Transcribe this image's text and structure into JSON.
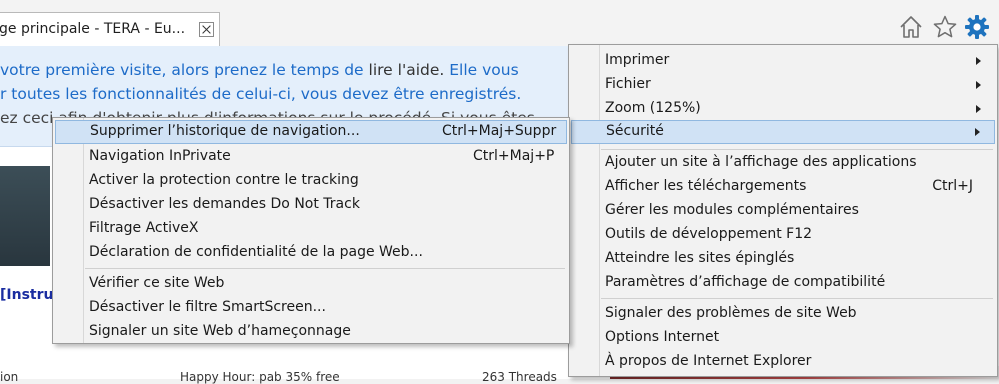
{
  "tab": {
    "title": "ge principale - TERA - Eu..."
  },
  "toolbar": {
    "home_icon": "home-icon",
    "favorites_icon": "star-icon",
    "tools_icon": "gear-icon",
    "accent": "#1e73be"
  },
  "page": {
    "notice_line1_a": "votre première visite, alors prenez le temps de ",
    "notice_line1_b": "lire l'aide.",
    "notice_line1_c": " Elle vous",
    "notice_line2": "r toutes les fonctionnalités de celui-ci, vous devez être enregistrés.",
    "notice_line3": "ez ceci afin d'obtenir plus d'informations sur le procédé. Si vous êtes",
    "instru": "[Instru",
    "bottom_left": "ion",
    "bottom_mid": "Happy Hour: pab 35% free",
    "bottom_right": "263 Threads"
  },
  "main_menu": {
    "items": [
      {
        "label": "Imprimer",
        "shortcut": "",
        "submenu": true
      },
      {
        "label": "Fichier",
        "shortcut": "",
        "submenu": true
      },
      {
        "label": "Zoom (125%)",
        "shortcut": "",
        "submenu": true
      },
      {
        "label": "Sécurité",
        "shortcut": "",
        "submenu": true
      },
      {
        "label": "Ajouter un site à l’affichage des applications",
        "shortcut": "",
        "submenu": false
      },
      {
        "label": "Afficher les téléchargements",
        "shortcut": "Ctrl+J",
        "submenu": false
      },
      {
        "label": "Gérer les modules complémentaires",
        "shortcut": "",
        "submenu": false
      },
      {
        "label": "Outils de développement F12",
        "shortcut": "",
        "submenu": false
      },
      {
        "label": "Atteindre les sites épinglés",
        "shortcut": "",
        "submenu": false
      },
      {
        "label": "Paramètres d’affichage de compatibilité",
        "shortcut": "",
        "submenu": false
      },
      {
        "label": "Signaler des problèmes de site Web",
        "shortcut": "",
        "submenu": false
      },
      {
        "label": "Options Internet",
        "shortcut": "",
        "submenu": false
      },
      {
        "label": "À propos de Internet Explorer",
        "shortcut": "",
        "submenu": false
      }
    ]
  },
  "security_menu": {
    "items": [
      {
        "label": "Supprimer l’historique de navigation...",
        "shortcut": "Ctrl+Maj+Suppr"
      },
      {
        "label": "Navigation InPrivate",
        "shortcut": "Ctrl+Maj+P"
      },
      {
        "label": "Activer la protection contre le tracking",
        "shortcut": ""
      },
      {
        "label": "Désactiver les demandes Do Not Track",
        "shortcut": ""
      },
      {
        "label": "Filtrage ActiveX",
        "shortcut": ""
      },
      {
        "label": "Déclaration de confidentialité de la page Web...",
        "shortcut": ""
      },
      {
        "label": "Vérifier ce site Web",
        "shortcut": ""
      },
      {
        "label": "Désactiver le filtre SmartScreen...",
        "shortcut": ""
      },
      {
        "label": "Signaler un site Web d’hameçonnage",
        "shortcut": ""
      }
    ]
  }
}
